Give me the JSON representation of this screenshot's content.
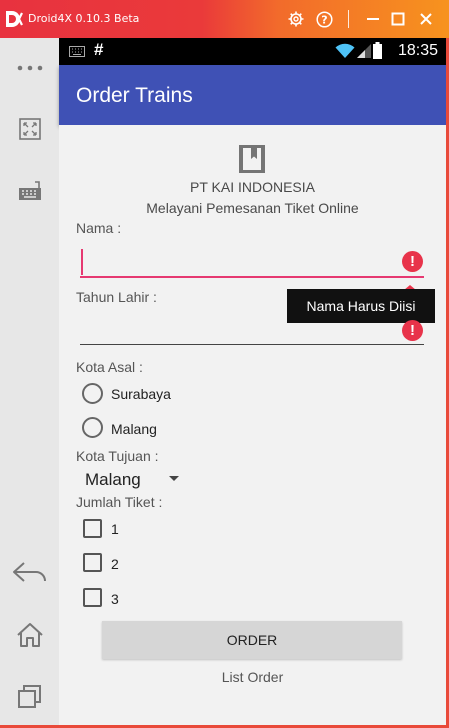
{
  "window": {
    "title": "Droid4X 0.10.3 Beta",
    "accent": "#e8323f"
  },
  "sidebar": {
    "items": [
      {
        "icon": "more-icon"
      },
      {
        "icon": "fullscreen-icon"
      },
      {
        "icon": "keyboard-icon"
      },
      {
        "icon": "back-icon"
      },
      {
        "icon": "home-icon"
      },
      {
        "icon": "recents-icon"
      }
    ]
  },
  "statusbar": {
    "time": "18:35",
    "left_glyph": "#"
  },
  "appbar": {
    "title": "Order Trains",
    "color": "#3f51b5"
  },
  "header": {
    "company": "PT KAI INDONESIA",
    "tagline": "Melayani Pemesanan Tiket Online"
  },
  "form": {
    "nama_label": "Nama :",
    "nama_value": "",
    "nama_error": "Nama Harus Diisi",
    "tahun_label": "Tahun Lahir :",
    "tahun_value": "",
    "kota_asal_label": "Kota Asal :",
    "kota_asal_options": [
      "Surabaya",
      "Malang"
    ],
    "kota_tujuan_label": "Kota Tujuan :",
    "kota_tujuan_selected": "Malang",
    "jumlah_label": "Jumlah Tiket :",
    "jumlah_options": [
      "1",
      "2",
      "3"
    ],
    "order_button": "ORDER",
    "list_order": "List Order",
    "error_color": "#e8334a"
  }
}
